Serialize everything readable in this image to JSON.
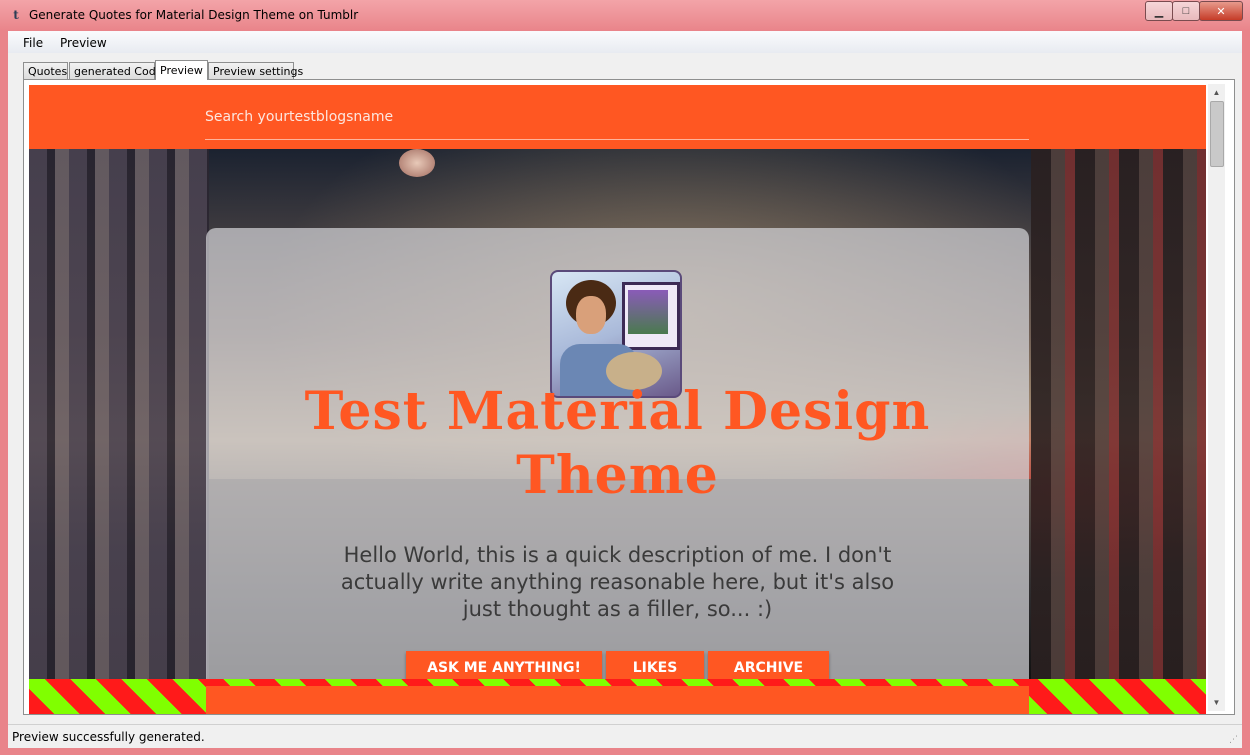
{
  "window": {
    "app_icon_glyph": "t",
    "title": "Generate Quotes for Material Design Theme on Tumblr",
    "minimize_glyph": "▁",
    "maximize_glyph": "□",
    "close_glyph": "✕"
  },
  "menu": {
    "items": [
      "File",
      "Preview"
    ]
  },
  "tabs": [
    "Quotes",
    "generated Code",
    "Preview",
    "Preview settings"
  ],
  "active_tab": "Preview",
  "preview": {
    "search_placeholder": "Search yourtestblogsname",
    "blog_title_line1": "Test Material Design",
    "blog_title_line2": "Theme",
    "description": "Hello World, this is a quick description of me. I don't actually write anything reasonable here, but it's also just thought as a filler, so... :)",
    "buttons": [
      "Ask me anything!",
      "Likes",
      "Archive"
    ],
    "accent_color": "#ff5722"
  },
  "scrollbar": {
    "up_glyph": "▲",
    "down_glyph": "▼"
  },
  "status": {
    "text": "Preview successfully generated.",
    "grip_glyph": "⋰"
  }
}
